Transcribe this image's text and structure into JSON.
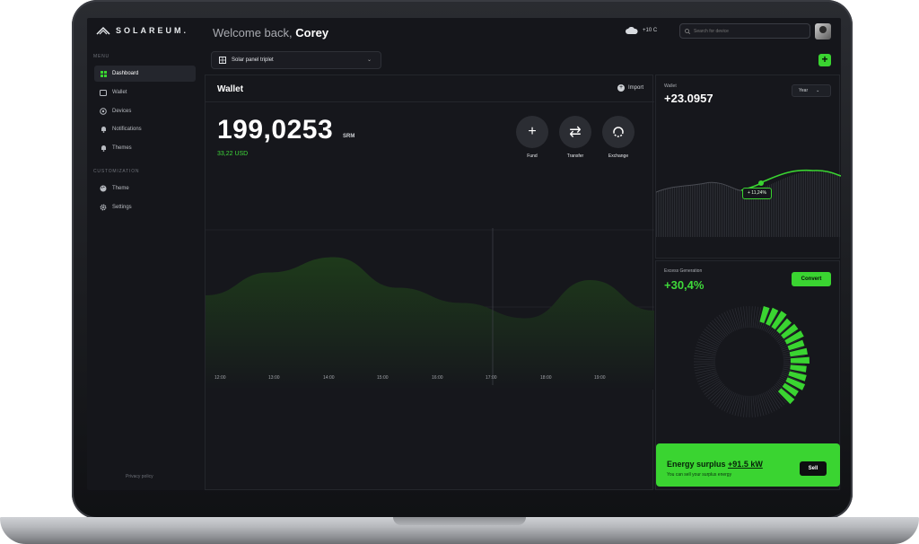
{
  "app": {
    "brand": "SOLAREUM.",
    "welcome_prefix": "Welcome back,",
    "user_name": "Corey"
  },
  "header": {
    "weather": "+10 C",
    "search_placeholder": "Search for device"
  },
  "sidebar": {
    "menu_label": "MENU",
    "items": [
      {
        "label": "Dashboard",
        "icon": "grid-icon",
        "active": true
      },
      {
        "label": "Wallet",
        "icon": "wallet-icon",
        "active": false
      },
      {
        "label": "Devices",
        "icon": "devices-icon",
        "active": false
      },
      {
        "label": "Notifications",
        "icon": "bell-icon",
        "active": false
      },
      {
        "label": "Themes",
        "icon": "bell-icon",
        "active": false
      }
    ],
    "customization_label": "CUSTOMIZATION",
    "custom_items": [
      {
        "label": "Theme",
        "icon": "palette-icon"
      },
      {
        "label": "Settings",
        "icon": "gear-icon"
      }
    ],
    "privacy": "Privacy policy"
  },
  "toolbar": {
    "device_selector": "Solar panel triplet"
  },
  "wallet": {
    "title": "Wallet",
    "import_label": "Import",
    "balance": "199,0253",
    "currency": "SRM",
    "usd_value": "33,22 USD",
    "actions": [
      {
        "label": "Fund"
      },
      {
        "label": "Transfer"
      },
      {
        "label": "Exchange"
      }
    ],
    "time_labels": [
      "12:00",
      "13:00",
      "14:00",
      "15:00",
      "16:00",
      "17:00",
      "18:00",
      "19:00"
    ]
  },
  "wallet_summary": {
    "label": "Wallet",
    "value": "+23.0957",
    "period": "Year",
    "tooltip": "+ 11,24%"
  },
  "excess": {
    "label": "Excess Generation",
    "value": "+30,4%",
    "convert_label": "Convert"
  },
  "surplus": {
    "title_prefix": "Energy surplus",
    "amount": "+91.5 kW",
    "subtitle": "You can sell your surplus energy",
    "sell_label": "Sell"
  },
  "colors": {
    "accent": "#3ad431",
    "background": "#15161b",
    "panel": "#16171c"
  },
  "chart_data": {
    "type": "area",
    "x": [
      "12:00",
      "13:00",
      "14:00",
      "15:00",
      "16:00",
      "17:00",
      "18:00",
      "19:00"
    ],
    "values": [
      0.5,
      0.65,
      0.75,
      0.55,
      0.45,
      0.35,
      0.6,
      0.4
    ]
  }
}
